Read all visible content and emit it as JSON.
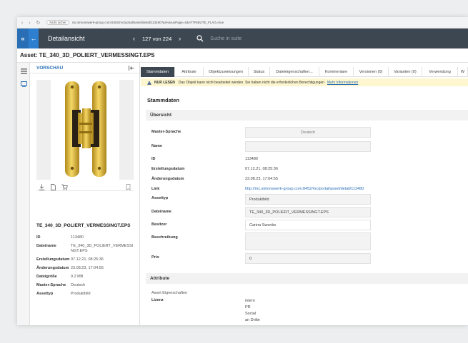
{
  "browser": {
    "secure_label": "Nicht sicher",
    "url": "mc.simonswerk-group.com:8452/mc/portal/asset/detail/113480?previousPage=4&ATTRIBUTE_FLAG=true"
  },
  "header": {
    "collapse_symbol": "«",
    "back_symbol": "←",
    "title": "Detailansicht",
    "prev_symbol": "‹",
    "counter": "127 von 224",
    "next_symbol": "›",
    "search_placeholder": "Suche in suite"
  },
  "asset_title": "Asset: TE_340_3D_POLIERT_VERMESSINGT.EPS",
  "preview": {
    "heading": "VORSCHAU",
    "filename": "TE_340_3D_POLIERT_VERMESSINGT.EPS",
    "meta": [
      {
        "key": "ID",
        "value": "113480"
      },
      {
        "key": "Dateiname",
        "value": "TE_340_3D_POLIERT_VERMESSINGT.EPS"
      },
      {
        "key": "Erstellungsdatum",
        "value": "07.12.21, 08:25:36"
      },
      {
        "key": "Änderungsdatum",
        "value": "23.08.23, 17:04:55"
      },
      {
        "key": "Dateigröße",
        "value": "9.2 MB"
      },
      {
        "key": "Master-Sprache",
        "value": "Deutsch"
      },
      {
        "key": "Assettyp",
        "value": "Produktbild"
      }
    ]
  },
  "tabs": [
    "Stammdaten",
    "Attribute",
    "Objektzuweisungen",
    "Status",
    "Dateieigenschaften...",
    "Kommentare",
    "Versionen (0)",
    "Varianten (0)",
    "Verwendung",
    "W"
  ],
  "warning": {
    "badge": "NUR LESEN",
    "text": "Das Objekt kann nicht bearbeitet werden. Sie haben nicht die erforderlichen Berechtigungen",
    "link": "Mehr Informationen"
  },
  "main": {
    "section_title": "Stammdaten",
    "overview_heading": "Übersicht",
    "fields": {
      "master_language_label": "Master-Sprache",
      "master_language_value": "Deutsch",
      "name_label": "Name",
      "name_value": "",
      "id_label": "ID",
      "id_value": "113480",
      "created_label": "Erstellungsdatum",
      "created_value": "07.12.21, 08:25:36",
      "modified_label": "Änderungsdatum",
      "modified_value": "23.08.23, 17:04:55",
      "link_label": "Link",
      "link_value": "http://mc.simonswerk-group.com:8452/mc/portal/asset/detail/113480",
      "assettype_label": "Assettyp",
      "assettype_value": "Produktbild",
      "filename_label": "Dateiname",
      "filename_value": "TE_340_3D_POLIERT_VERMESSINGT.EPS",
      "owner_label": "Besitzer",
      "owner_value": "Carina Swonke",
      "description_label": "Beschreibung",
      "description_value": "",
      "priority_label": "Prio",
      "priority_value": "0"
    },
    "attributes_heading": "Attribute",
    "asset_properties_label": "Asset Eigenschaften",
    "license_label": "Lizenz",
    "license_values": [
      "intern",
      "PR",
      "Social",
      "an Dritte"
    ]
  },
  "colors": {
    "accent": "#2a6fb6",
    "header": "#3d4752",
    "warning_bg": "#fdf6cf"
  }
}
